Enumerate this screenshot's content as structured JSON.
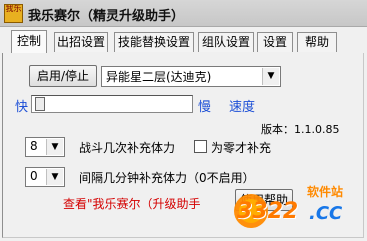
{
  "window": {
    "title": "我乐赛尔（精灵升级助手）",
    "icon_text": "我乐"
  },
  "tabs": [
    {
      "label": "控制",
      "active": true
    },
    {
      "label": "出招设置",
      "active": false
    },
    {
      "label": "技能替换设置",
      "active": false
    },
    {
      "label": "组队设置",
      "active": false
    },
    {
      "label": "设置",
      "active": false
    },
    {
      "label": "帮助",
      "active": false
    }
  ],
  "control": {
    "start_stop_label": "启用/停止",
    "map_select_value": "异能星二层(达迪克)",
    "speed": {
      "fast_label": "快",
      "slow_label": "慢",
      "title": "速度",
      "level": 0.03
    },
    "version_label": "版本：1.1.0.85",
    "battle_count": {
      "value": "8",
      "label": "战斗几次补充体力",
      "zero_checkbox_label": "为零才补充",
      "zero_checked": false
    },
    "interval": {
      "value": "0",
      "label": "间隔几分钟补充体力（0不启用）"
    },
    "footer_link": "查看\"我乐赛尔（升级助手",
    "footer_button": "使用帮助"
  },
  "watermark": {
    "text": "软件站",
    "number": "3322",
    "domain": ".CC"
  },
  "colors": {
    "accent_blue": "#1c4fd6",
    "link_red": "#d40000",
    "watermark_orange": "#ff8a00"
  }
}
